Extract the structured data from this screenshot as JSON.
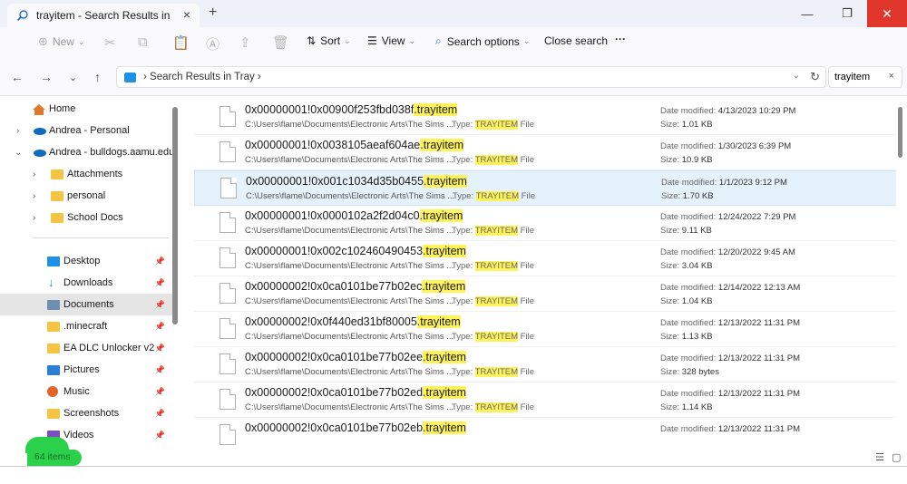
{
  "window": {
    "tab_title": "trayitem - Search Results in Tr",
    "tab_close": "×",
    "new_tab": "+",
    "min": "—",
    "max": "❐",
    "close": "✕"
  },
  "commandbar": {
    "new_label": "New",
    "sort_label": "Sort",
    "view_label": "View",
    "search_options_label": "Search options",
    "close_search_label": "Close search",
    "more_label": "···"
  },
  "address": {
    "path": "›  Search Results in Tray  ›",
    "search_value": "trayitem",
    "search_clear": "×"
  },
  "sidebar": {
    "home": "Home",
    "andrea_personal": "Andrea - Personal",
    "andrea_bulldogs": "Andrea - bulldogs.aamu.edu",
    "attachments": "Attachments",
    "personal": "personal",
    "school_docs": "School Docs",
    "desktop": "Desktop",
    "downloads": "Downloads",
    "documents": "Documents",
    "minecraft": ".minecraft",
    "ea_dlc": "EA DLC Unlocker v2",
    "pictures": "Pictures",
    "music": "Music",
    "screenshots": "Screenshots",
    "videos": "Videos"
  },
  "files": [
    {
      "name": "0x00000001!0x00900f253fbd038f",
      "ext": ".trayitem",
      "path": "C:\\Users\\flame\\Documents\\Electronic Arts\\The Sims ...",
      "type_prefix": "Type: ",
      "type": "TRAYITEM",
      "type_suffix": " File",
      "date_label": "Date modified: ",
      "date": "4/13/2023 10:29 PM",
      "size_label": "Size: ",
      "size": "1.01 KB"
    },
    {
      "name": "0x00000001!0x0038105aeaf604ae",
      "ext": ".trayitem",
      "path": "C:\\Users\\flame\\Documents\\Electronic Arts\\The Sims ...",
      "type_prefix": "Type: ",
      "type": "TRAYITEM",
      "type_suffix": " File",
      "date_label": "Date modified: ",
      "date": "1/30/2023 6:39 PM",
      "size_label": "Size: ",
      "size": "10.9 KB"
    },
    {
      "name": "0x00000001!0x001c1034d35b0455",
      "ext": ".trayitem",
      "path": "C:\\Users\\flame\\Documents\\Electronic Arts\\The Sims ...",
      "type_prefix": "Type: ",
      "type": "TRAYITEM",
      "type_suffix": " File",
      "date_label": "Date modified: ",
      "date": "1/1/2023 9:12 PM",
      "size_label": "Size: ",
      "size": "1.70 KB"
    },
    {
      "name": "0x00000001!0x0000102a2f2d04c0",
      "ext": ".trayitem",
      "path": "C:\\Users\\flame\\Documents\\Electronic Arts\\The Sims ...",
      "type_prefix": "Type: ",
      "type": "TRAYITEM",
      "type_suffix": " File",
      "date_label": "Date modified: ",
      "date": "12/24/2022 7:29 PM",
      "size_label": "Size: ",
      "size": "9.11 KB"
    },
    {
      "name": "0x00000001!0x002c102460490453",
      "ext": ".trayitem",
      "path": "C:\\Users\\flame\\Documents\\Electronic Arts\\The Sims ...",
      "type_prefix": "Type: ",
      "type": "TRAYITEM",
      "type_suffix": " File",
      "date_label": "Date modified: ",
      "date": "12/20/2022 9:45 AM",
      "size_label": "Size: ",
      "size": "3.04 KB"
    },
    {
      "name": "0x00000002!0x0ca0101be77b02ec",
      "ext": ".trayitem",
      "path": "C:\\Users\\flame\\Documents\\Electronic Arts\\The Sims ...",
      "type_prefix": "Type: ",
      "type": "TRAYITEM",
      "type_suffix": " File",
      "date_label": "Date modified: ",
      "date": "12/14/2022 12:13 AM",
      "size_label": "Size: ",
      "size": "1.04 KB"
    },
    {
      "name": "0x00000002!0x0f440ed31bf80005",
      "ext": ".trayitem",
      "path": "C:\\Users\\flame\\Documents\\Electronic Arts\\The Sims ...",
      "type_prefix": "Type: ",
      "type": "TRAYITEM",
      "type_suffix": " File",
      "date_label": "Date modified: ",
      "date": "12/13/2022 11:31 PM",
      "size_label": "Size: ",
      "size": "1.13 KB"
    },
    {
      "name": "0x00000002!0x0ca0101be77b02ee",
      "ext": ".trayitem",
      "path": "C:\\Users\\flame\\Documents\\Electronic Arts\\The Sims ...",
      "type_prefix": "Type: ",
      "type": "TRAYITEM",
      "type_suffix": " File",
      "date_label": "Date modified: ",
      "date": "12/13/2022 11:31 PM",
      "size_label": "Size: ",
      "size": "328 bytes"
    },
    {
      "name": "0x00000002!0x0ca0101be77b02ed",
      "ext": ".trayitem",
      "path": "C:\\Users\\flame\\Documents\\Electronic Arts\\The Sims ...",
      "type_prefix": "Type: ",
      "type": "TRAYITEM",
      "type_suffix": " File",
      "date_label": "Date modified: ",
      "date": "12/13/2022 11:31 PM",
      "size_label": "Size: ",
      "size": "1.14 KB"
    },
    {
      "name": "0x00000002!0x0ca0101be77b02eb",
      "ext": ".trayitem",
      "path": "",
      "type_prefix": "",
      "type": "",
      "type_suffix": "",
      "date_label": "Date modified: ",
      "date": "12/13/2022 11:31 PM",
      "size_label": "",
      "size": ""
    }
  ],
  "status": {
    "count": "64 items"
  },
  "colors": {
    "accent": "#1e90e6",
    "highlight": "#fff35c",
    "selected_row": "#e5f1fb",
    "close_button": "#e0362c",
    "status_marker": "#2bd14a"
  }
}
